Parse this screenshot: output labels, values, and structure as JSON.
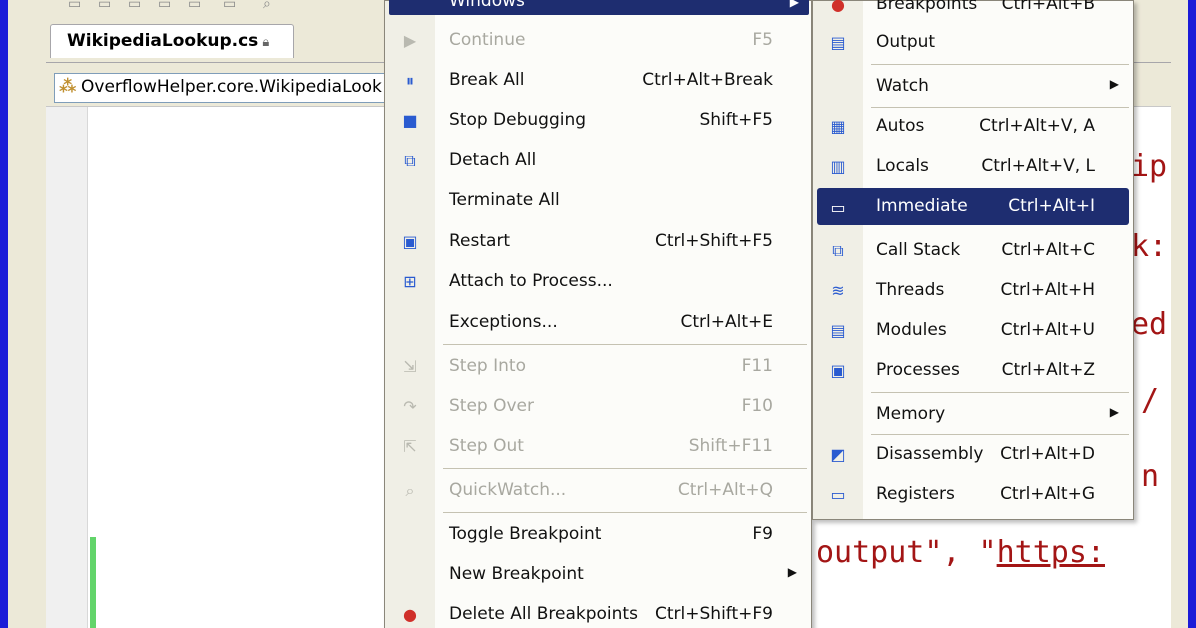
{
  "editor": {
    "tab_title": "WikipediaLookup.cs",
    "nav_class": "OverflowHelper.core.WikipediaLook",
    "code_line_1": "output\", \"",
    "code_line_1_url": "https:",
    "right_fragments": [
      "ip",
      "k:",
      "ed",
      "/",
      "n"
    ]
  },
  "debug_menu": {
    "windows": {
      "label": "Windows",
      "submenu_arrow": "▶"
    },
    "items": [
      {
        "label": "Continue",
        "shortcut": "F5",
        "icon": "play-icon"
      },
      {
        "label": "Break All",
        "shortcut": "Ctrl+Alt+Break",
        "icon": "pause-icon"
      },
      {
        "label": "Stop Debugging",
        "shortcut": "Shift+F5",
        "icon": "stop-icon"
      },
      {
        "label": "Detach All",
        "shortcut": "",
        "icon": "detach-icon"
      },
      {
        "label": "Terminate All",
        "shortcut": "",
        "icon": ""
      },
      {
        "label": "Restart",
        "shortcut": "Ctrl+Shift+F5",
        "icon": "restart-icon"
      },
      {
        "label": "Attach to Process...",
        "shortcut": "",
        "icon": "attach-icon"
      },
      {
        "label": "Exceptions...",
        "shortcut": "Ctrl+Alt+E",
        "icon": ""
      },
      {
        "label": "Step Into",
        "shortcut": "F11",
        "icon": "step-into-icon"
      },
      {
        "label": "Step Over",
        "shortcut": "F10",
        "icon": "step-over-icon"
      },
      {
        "label": "Step Out",
        "shortcut": "Shift+F11",
        "icon": "step-out-icon"
      },
      {
        "label": "QuickWatch...",
        "shortcut": "Ctrl+Alt+Q",
        "icon": "quickwatch-icon"
      },
      {
        "label": "Toggle Breakpoint",
        "shortcut": "F9",
        "icon": ""
      },
      {
        "label": "New Breakpoint",
        "shortcut": "",
        "icon": "",
        "submenu_arrow": "▶"
      },
      {
        "label": "Delete All Breakpoints",
        "shortcut": "Ctrl+Shift+F9",
        "icon": "delete-breakpoints-icon"
      }
    ]
  },
  "windows_submenu": {
    "items": [
      {
        "label": "Breakpoints",
        "shortcut": "Ctrl+Alt+B",
        "icon": "breakpoints-icon"
      },
      {
        "label": "Output",
        "shortcut": "",
        "icon": "output-icon"
      },
      {
        "label": "Watch",
        "shortcut": "",
        "icon": "",
        "submenu_arrow": "▶"
      },
      {
        "label": "Autos",
        "shortcut": "Ctrl+Alt+V, A",
        "icon": "autos-icon"
      },
      {
        "label": "Locals",
        "shortcut": "Ctrl+Alt+V, L",
        "icon": "locals-icon"
      },
      {
        "label": "Immediate",
        "shortcut": "Ctrl+Alt+I",
        "icon": "immediate-icon"
      },
      {
        "label": "Call Stack",
        "shortcut": "Ctrl+Alt+C",
        "icon": "call-stack-icon"
      },
      {
        "label": "Threads",
        "shortcut": "Ctrl+Alt+H",
        "icon": "threads-icon"
      },
      {
        "label": "Modules",
        "shortcut": "Ctrl+Alt+U",
        "icon": "modules-icon"
      },
      {
        "label": "Processes",
        "shortcut": "Ctrl+Alt+Z",
        "icon": "processes-icon"
      },
      {
        "label": "Memory",
        "shortcut": "",
        "icon": "",
        "submenu_arrow": "▶"
      },
      {
        "label": "Disassembly",
        "shortcut": "Ctrl+Alt+D",
        "icon": "disassembly-icon"
      },
      {
        "label": "Registers",
        "shortcut": "Ctrl+Alt+G",
        "icon": "registers-icon"
      }
    ]
  },
  "colors": {
    "border_blue": "#1b1bd8",
    "highlight": "#1e2d70",
    "code_string": "#a31515",
    "change_bar": "#62d46a"
  }
}
